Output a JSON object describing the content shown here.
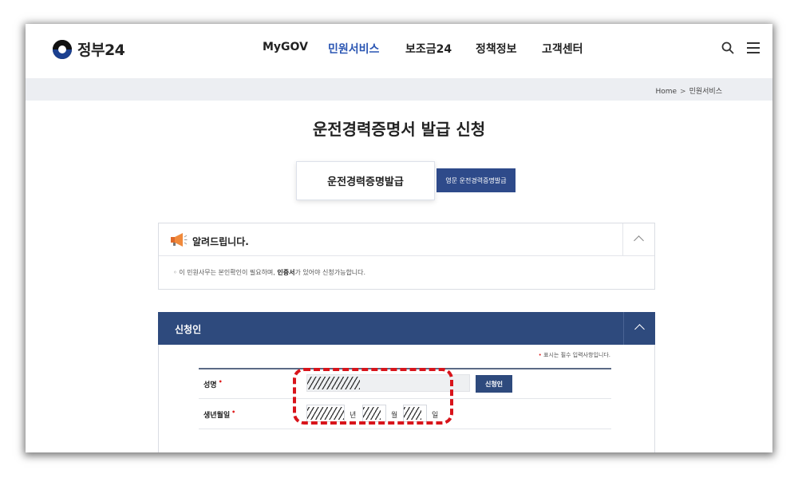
{
  "header": {
    "logo_text": "정부24",
    "nav": [
      "MyGOV",
      "민원서비스",
      "보조금24",
      "정책정보",
      "고객센터"
    ],
    "active_nav": "민원서비스",
    "icons": [
      "search-icon",
      "menu-icon"
    ]
  },
  "breadcrumb": {
    "home": "Home",
    "separator": ">",
    "current": "민원서비스"
  },
  "page": {
    "title": "운전경력증명서 발급 신청"
  },
  "tabs": {
    "main": "운전경력증명발급",
    "english": "영문 운전경력증명발급"
  },
  "notice": {
    "title": "알려드립니다.",
    "text_before": "이 민원사무는 본인확인이 필요하며, ",
    "text_bold": "인증서",
    "text_after": "가 있어야 신청가능합니다."
  },
  "applicant": {
    "section_title": "신청인",
    "required_note": "표시는 필수 입력사항입니다.",
    "name_label": "성명",
    "birth_label": "생년월일",
    "applicant_button": "신청인",
    "year_unit": "년",
    "month_unit": "월",
    "day_unit": "일"
  },
  "colors": {
    "accent": "#2b56b3",
    "navy": "#2e4a7d",
    "required": "#e02020",
    "highlight": "#d8141b"
  }
}
